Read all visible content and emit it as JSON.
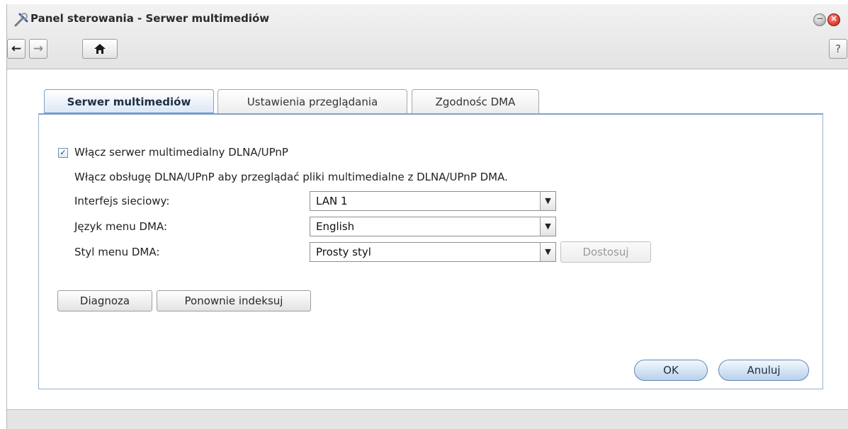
{
  "window": {
    "title": "Panel sterowania - Serwer multimediów",
    "help_label": "?"
  },
  "nav": {
    "back_icon": "arrow-left",
    "forward_icon": "arrow-right",
    "home_icon": "home"
  },
  "tabs": [
    {
      "label": "Serwer multimediów",
      "active": true
    },
    {
      "label": "Ustawienia przeglądania",
      "active": false
    },
    {
      "label": "Zgodnośc DMA",
      "active": false
    }
  ],
  "form": {
    "enable_checkbox": {
      "label": "Włącz serwer multimedialny DLNA/UPnP",
      "checked": true
    },
    "description": "Włącz obsługę DLNA/UPnP aby przeglądać pliki multimedialne z DLNA/UPnP DMA.",
    "network_interface": {
      "label": "Interfejs sieciowy:",
      "value": "LAN 1"
    },
    "dma_language": {
      "label": "Język menu DMA:",
      "value": "English"
    },
    "dma_style": {
      "label": "Styl menu DMA:",
      "value": "Prosty styl"
    },
    "customize_label": "Dostosuj",
    "diagnose_label": "Diagnoza",
    "reindex_label": "Ponownie indeksuj"
  },
  "actions": {
    "ok_label": "OK",
    "cancel_label": "Anuluj"
  },
  "colors": {
    "accent": "#5a8fc9",
    "close": "#c8180f"
  }
}
